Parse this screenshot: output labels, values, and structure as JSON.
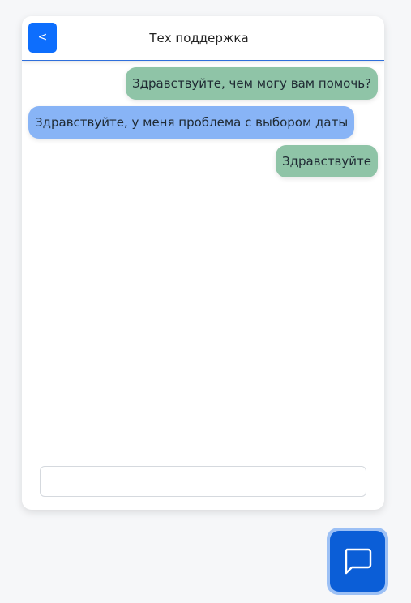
{
  "header": {
    "back_label": "<",
    "title": "Тех поддержка"
  },
  "messages": [
    {
      "sender": "support",
      "text": "Здравствуйте, чем могу вам помочь?"
    },
    {
      "sender": "user",
      "text": "Здравствуйте, у меня проблема с выбором даты"
    },
    {
      "sender": "support",
      "text": "Здравствуйте"
    }
  ],
  "input": {
    "value": "",
    "placeholder": ""
  },
  "fab": {
    "icon": "chat-bubble-icon"
  },
  "colors": {
    "accent": "#0d6efd",
    "support_bubble": "#8fc4a7",
    "user_bubble": "#88b4f6",
    "fab": "#0b5ed7"
  }
}
